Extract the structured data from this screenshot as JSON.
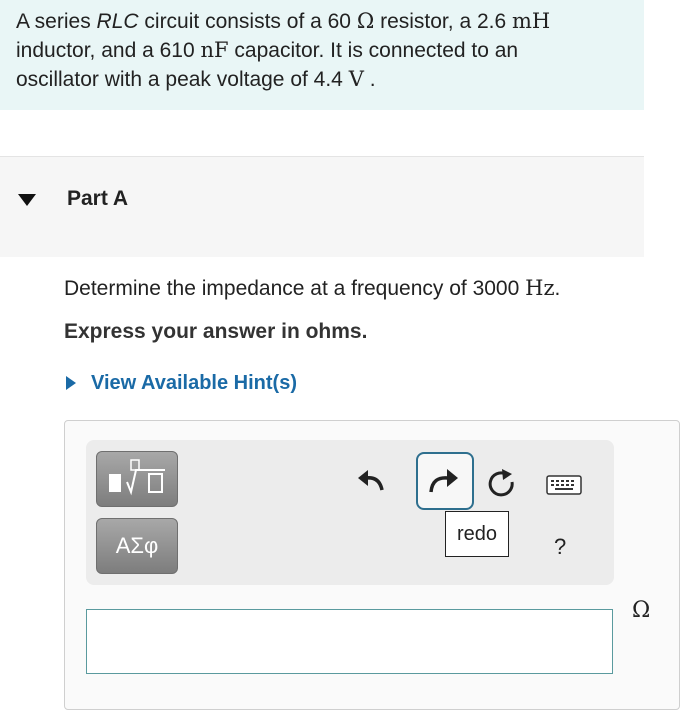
{
  "problem": {
    "text_1": "A series ",
    "text_rlc": "RLC",
    "text_2": " circuit consists of a 60 ",
    "ohm_symbol": "Ω",
    "text_3": " resistor, a 2.6 ",
    "mH": "mH",
    "text_4": "inductor, and a 610 ",
    "nF": "nF",
    "text_5": " capacitor. It is connected to an",
    "text_6": "oscillator with a peak voltage of 4.4 ",
    "V": "V",
    "text_7": " ."
  },
  "part": {
    "title": "Part A"
  },
  "question": {
    "text": "Determine the impedance at a frequency of 3000 ",
    "unit": "Hz",
    "period": ".",
    "instruction": "Express your answer in ohms."
  },
  "hint": {
    "label": "View Available Hint(s)"
  },
  "toolbar": {
    "symbols_label": "ΑΣφ",
    "redo_tooltip": "redo",
    "help_label": "?"
  },
  "answer": {
    "value": "",
    "placeholder": "",
    "unit": "Ω"
  },
  "colors": {
    "problem_bg": "#e9f6f6",
    "link": "#1a6aa6",
    "active_border": "#2e6f8e",
    "input_border": "#5a9a9e"
  }
}
